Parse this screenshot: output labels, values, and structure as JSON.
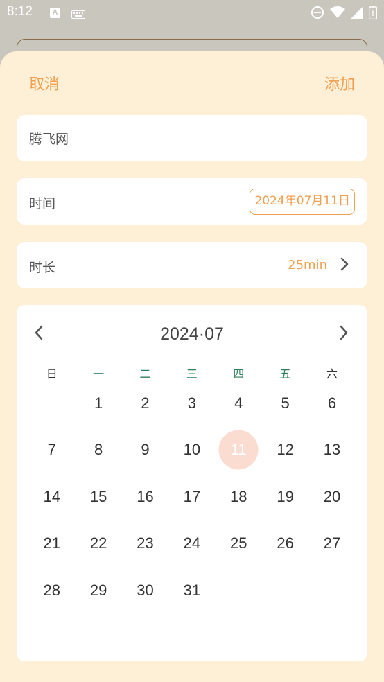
{
  "status_bar": {
    "time": "8:12",
    "icons": [
      "a-notification-icon",
      "keyboard-icon",
      "do-not-disturb-icon",
      "wifi-icon",
      "signal-icon",
      "battery-icon"
    ]
  },
  "sheet": {
    "cancel_label": "取消",
    "add_label": "添加",
    "name_value": "腾飞网",
    "time_label": "时间",
    "date_value": "2024年07月11日",
    "duration_label": "时长",
    "duration_value": "25min"
  },
  "calendar": {
    "title": "2024·07",
    "weekdays": [
      "日",
      "一",
      "二",
      "三",
      "四",
      "五",
      "六"
    ],
    "first_weekday_offset": 1,
    "days_in_month": 31,
    "selected_day": 11
  },
  "colors": {
    "accent": "#f0a050",
    "sheet_bg": "#fef0d6",
    "weekday_green": "#2e7d5b",
    "weekday_default": "#333333",
    "selected_fill": "#fbdcd0"
  }
}
